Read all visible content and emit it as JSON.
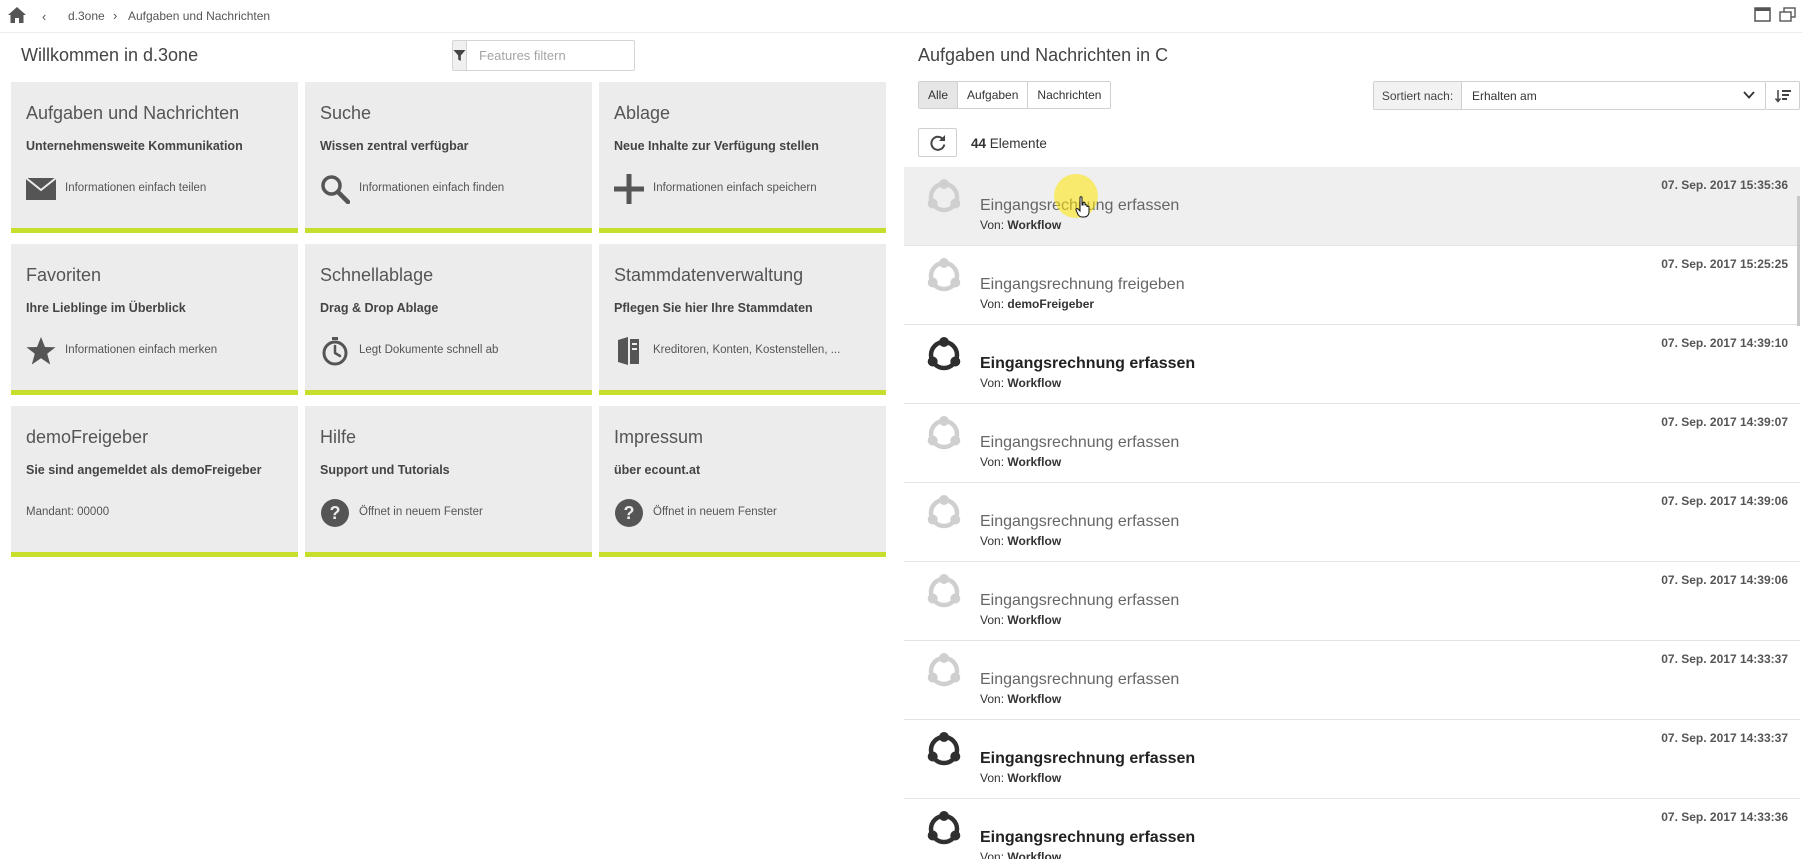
{
  "breadcrumb": {
    "items": [
      "d.3one",
      "Aufgaben und Nachrichten"
    ]
  },
  "left": {
    "title": "Willkommen in d.3one",
    "filter_placeholder": "Features filtern",
    "tiles": [
      {
        "title": "Aufgaben und Nachrichten",
        "subtitle": "Unternehmensweite Kommunikation",
        "desc": "Informationen einfach teilen",
        "icon": "envelope-icon"
      },
      {
        "title": "Suche",
        "subtitle": "Wissen zentral verfügbar",
        "desc": "Informationen einfach finden",
        "icon": "search-icon"
      },
      {
        "title": "Ablage",
        "subtitle": "Neue Inhalte zur Verfügung stellen",
        "desc": "Informationen einfach speichern",
        "icon": "plus-icon"
      },
      {
        "title": "Favoriten",
        "subtitle": "Ihre Lieblinge im Überblick",
        "desc": "Informationen einfach merken",
        "icon": "star-icon"
      },
      {
        "title": "Schnellablage",
        "subtitle": "Drag & Drop Ablage",
        "desc": "Legt Dokumente schnell ab",
        "icon": "stopwatch-icon"
      },
      {
        "title": "Stammdatenverwaltung",
        "subtitle": "Pflegen Sie hier Ihre Stammdaten",
        "desc": "Kreditoren, Konten, Kostenstellen, ...",
        "icon": "binder-icon"
      },
      {
        "title": "demoFreigeber",
        "subtitle": "Sie sind angemeldet als demoFreigeber",
        "desc": "Mandant: 00000",
        "icon": ""
      },
      {
        "title": "Hilfe",
        "subtitle": "Support und Tutorials",
        "desc": "Öffnet in neuem Fenster",
        "icon": "help-icon"
      },
      {
        "title": "Impressum",
        "subtitle": "über ecount.at",
        "desc": "Öffnet in neuem Fenster",
        "icon": "help-icon"
      }
    ]
  },
  "right": {
    "title": "Aufgaben und Nachrichten in C",
    "filters": [
      "Alle",
      "Aufgaben",
      "Nachrichten"
    ],
    "active_filter": "Alle",
    "sort_label": "Sortiert nach:",
    "sort_value": "Erhalten am",
    "count_number": "44",
    "count_label": "Elemente",
    "from_prefix": "Von:",
    "items": [
      {
        "title": "Eingangsrechnung erfassen",
        "from": "Workflow",
        "date": "07. Sep. 2017 15:35:36",
        "unread": false,
        "selected": true
      },
      {
        "title": "Eingangsrechnung freigeben",
        "from": "demoFreigeber",
        "date": "07. Sep. 2017 15:25:25",
        "unread": false,
        "selected": false
      },
      {
        "title": "Eingangsrechnung erfassen",
        "from": "Workflow",
        "date": "07. Sep. 2017 14:39:10",
        "unread": true,
        "selected": false
      },
      {
        "title": "Eingangsrechnung erfassen",
        "from": "Workflow",
        "date": "07. Sep. 2017 14:39:07",
        "unread": false,
        "selected": false
      },
      {
        "title": "Eingangsrechnung erfassen",
        "from": "Workflow",
        "date": "07. Sep. 2017 14:39:06",
        "unread": false,
        "selected": false
      },
      {
        "title": "Eingangsrechnung erfassen",
        "from": "Workflow",
        "date": "07. Sep. 2017 14:39:06",
        "unread": false,
        "selected": false
      },
      {
        "title": "Eingangsrechnung erfassen",
        "from": "Workflow",
        "date": "07. Sep. 2017 14:33:37",
        "unread": false,
        "selected": false
      },
      {
        "title": "Eingangsrechnung erfassen",
        "from": "Workflow",
        "date": "07. Sep. 2017 14:33:37",
        "unread": true,
        "selected": false
      },
      {
        "title": "Eingangsrechnung erfassen",
        "from": "Workflow",
        "date": "07. Sep. 2017 14:33:36",
        "unread": true,
        "selected": false
      }
    ]
  },
  "colors": {
    "accent": "#c8de2d",
    "tile_bg": "#ececec",
    "icon_read": "#cfcfcf",
    "icon_unread": "#2f2f2f"
  }
}
